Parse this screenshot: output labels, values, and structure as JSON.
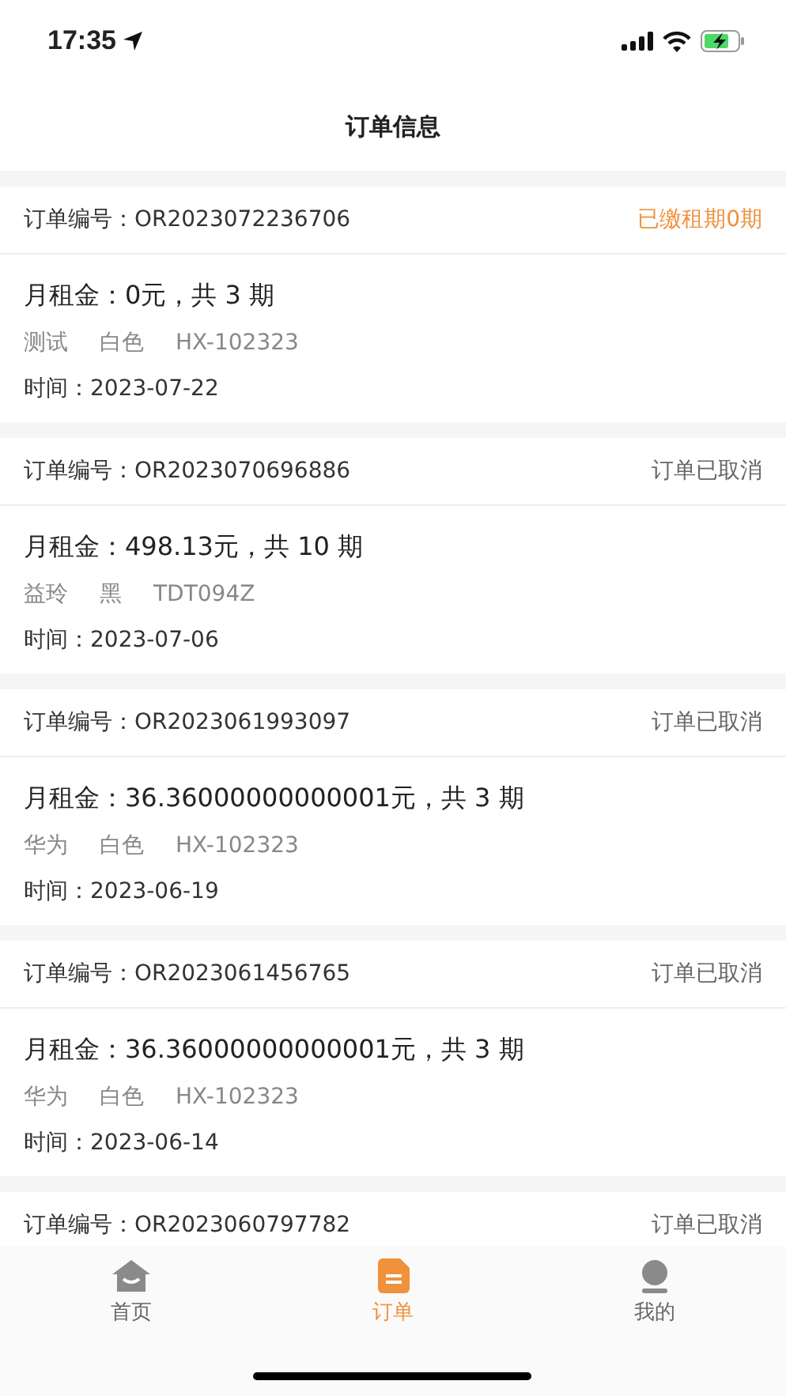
{
  "status_bar": {
    "time": "17:35"
  },
  "nav": {
    "title": "订单信息"
  },
  "orders": [
    {
      "label": "订单编号：",
      "number": "OR2023072236706",
      "status": "已缴租期0期",
      "highlighted": true,
      "rent": "月租金：",
      "amount": "0元，共 3 期",
      "brand": "测试",
      "color_name": "白色",
      "model": "HX-102323",
      "time": "时间：2023-07-22"
    },
    {
      "label": "订单编号：",
      "number": "OR2023070696886",
      "status": "订单已取消",
      "highlighted": false,
      "rent": "月租金：",
      "amount": "498.13元，共 10 期",
      "brand": "益玲",
      "color_name": "黑",
      "model": "TDT094Z",
      "time": "时间：2023-07-06"
    },
    {
      "label": "订单编号：",
      "number": "OR2023061993097",
      "status": "订单已取消",
      "highlighted": false,
      "rent": "月租金：",
      "amount": "36.36000000000001元，共 3 期",
      "brand": "华为",
      "color_name": "白色",
      "model": "HX-102323",
      "time": "时间：2023-06-19"
    },
    {
      "label": "订单编号：",
      "number": "OR2023061456765",
      "status": "订单已取消",
      "highlighted": false,
      "rent": "月租金：",
      "amount": "36.36000000000001元，共 3 期",
      "brand": "华为",
      "color_name": "白色",
      "model": "HX-102323",
      "time": "时间：2023-06-14"
    },
    {
      "label": "订单编号：",
      "number": "OR2023060797782",
      "status": "订单已取消",
      "highlighted": false
    }
  ],
  "tabs": [
    {
      "label": "首页",
      "selected": false
    },
    {
      "label": "订单",
      "selected": true
    },
    {
      "label": "我的",
      "selected": false
    }
  ]
}
